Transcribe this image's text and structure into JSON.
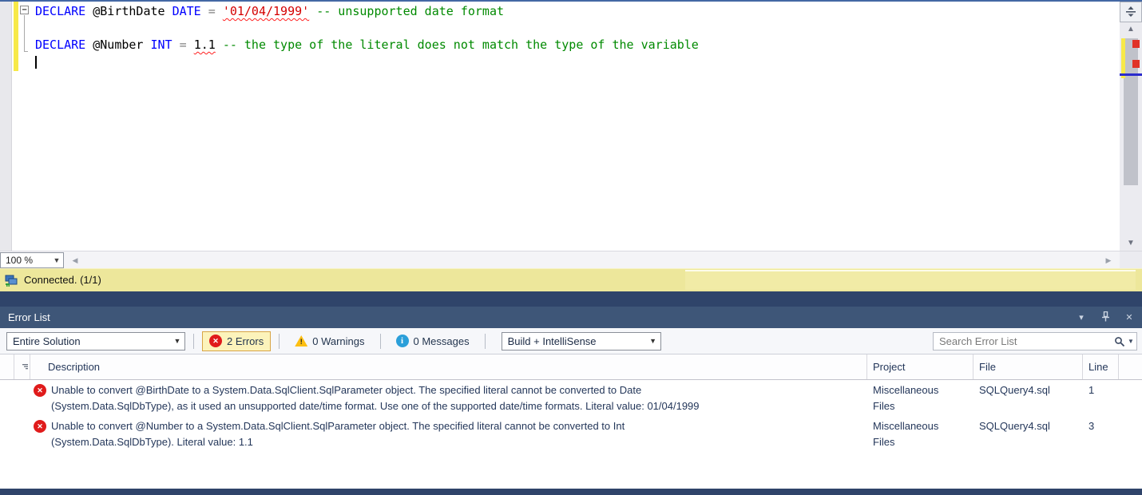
{
  "editor": {
    "zoom_level": "100 %",
    "code_lines": [
      {
        "tokens": [
          {
            "text": "DECLARE",
            "type": "keyword"
          },
          {
            "text": " ",
            "type": "plain"
          },
          {
            "text": "@BirthDate",
            "type": "variable"
          },
          {
            "text": " ",
            "type": "plain"
          },
          {
            "text": "DATE",
            "type": "keyword"
          },
          {
            "text": " ",
            "type": "plain"
          },
          {
            "text": "=",
            "type": "operator"
          },
          {
            "text": " ",
            "type": "plain"
          },
          {
            "text": "'01/04/1999'",
            "type": "string-error"
          },
          {
            "text": " ",
            "type": "plain"
          },
          {
            "text": "-- unsupported date format",
            "type": "comment"
          }
        ]
      },
      {
        "tokens": []
      },
      {
        "tokens": [
          {
            "text": "DECLARE",
            "type": "keyword"
          },
          {
            "text": " ",
            "type": "plain"
          },
          {
            "text": "@Number",
            "type": "variable"
          },
          {
            "text": " ",
            "type": "plain"
          },
          {
            "text": "INT",
            "type": "keyword"
          },
          {
            "text": " ",
            "type": "plain"
          },
          {
            "text": "=",
            "type": "operator"
          },
          {
            "text": " ",
            "type": "plain"
          },
          {
            "text": "1.1",
            "type": "number-error"
          },
          {
            "text": " ",
            "type": "plain"
          },
          {
            "text": "-- the type of the literal does not match the type of the variable",
            "type": "comment"
          }
        ]
      },
      {
        "tokens": [],
        "caret": true
      }
    ]
  },
  "status_bar": {
    "connection_text": "Connected. (1/1)"
  },
  "error_list": {
    "title": "Error List",
    "toolbar": {
      "scope_selector": "Entire Solution",
      "errors_label": "2 Errors",
      "warnings_label": "0 Warnings",
      "messages_label": "0 Messages",
      "source_selector": "Build + IntelliSense",
      "search_placeholder": "Search Error List"
    },
    "columns": {
      "description": "Description",
      "project": "Project",
      "file": "File",
      "line": "Line"
    },
    "rows": [
      {
        "description_line1": "Unable to convert @BirthDate to a System.Data.SqlClient.SqlParameter object. The specified literal cannot be converted to Date",
        "description_line2": "(System.Data.SqlDbType), as it used an unsupported date/time format. Use one of the supported date/time formats. Literal value: 01/04/1999",
        "project": "Miscellaneous Files",
        "file": "SQLQuery4.sql",
        "line": "1"
      },
      {
        "description_line1": "Unable to convert @Number to a System.Data.SqlClient.SqlParameter object. The specified literal cannot be converted to Int",
        "description_line2": "(System.Data.SqlDbType). Literal value: 1.1",
        "project": "Miscellaneous Files",
        "file": "SQLQuery4.sql",
        "line": "3"
      }
    ]
  },
  "colors": {
    "keyword_blue": "#0000ff",
    "string_literal_red": "#d40000",
    "comment_green": "#008a00",
    "operator_gray": "#7f7f7f",
    "error_red": "#e01b1b",
    "warning_yellow": "#fdbf12",
    "info_blue": "#2b9fd9",
    "status_bar_yellow": "#ede79b",
    "panel_title_blue": "#3e5678",
    "change_tracking_yellow": "#f7e948"
  }
}
